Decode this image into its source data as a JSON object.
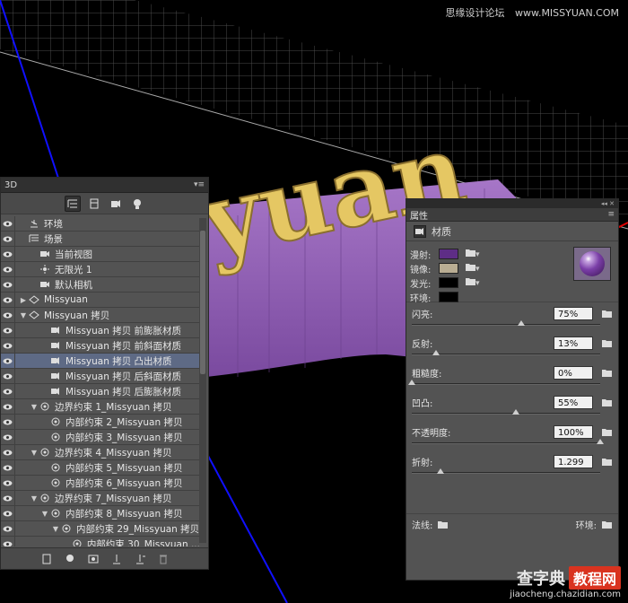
{
  "watermark": {
    "top_site": "思缘设计论坛",
    "top_url": "www.MISSYUAN.COM",
    "bottom_brand_a": "查字典",
    "bottom_brand_b": "教程网",
    "bottom_url": "jiaocheng.chazidian.com"
  },
  "scene_text": "yuan",
  "panel3d": {
    "tab": "3D",
    "rows": [
      {
        "label": "环境",
        "icon": "environment-icon",
        "depth": 0,
        "arrow": ""
      },
      {
        "label": "场景",
        "icon": "scene-icon",
        "depth": 0,
        "arrow": ""
      },
      {
        "label": "当前视图",
        "icon": "camera-view-icon",
        "depth": 1,
        "arrow": ""
      },
      {
        "label": "无限光 1",
        "icon": "light-icon",
        "depth": 1,
        "arrow": ""
      },
      {
        "label": "默认相机",
        "icon": "camera-icon",
        "depth": 1,
        "arrow": ""
      },
      {
        "label": "Missyuan",
        "icon": "mesh-icon",
        "depth": 0,
        "arrow": "▶"
      },
      {
        "label": "Missyuan 拷贝",
        "icon": "mesh-icon",
        "depth": 0,
        "arrow": "▼"
      },
      {
        "label": "Missyuan 拷贝 前膨胀材质",
        "icon": "material-icon",
        "depth": 2,
        "arrow": ""
      },
      {
        "label": "Missyuan 拷贝 前斜面材质",
        "icon": "material-icon",
        "depth": 2,
        "arrow": ""
      },
      {
        "label": "Missyuan 拷贝 凸出材质",
        "icon": "material-icon",
        "depth": 2,
        "arrow": "",
        "selected": true
      },
      {
        "label": "Missyuan 拷贝 后斜面材质",
        "icon": "material-icon",
        "depth": 2,
        "arrow": ""
      },
      {
        "label": "Missyuan 拷贝 后膨胀材质",
        "icon": "material-icon",
        "depth": 2,
        "arrow": ""
      },
      {
        "label": "边界约束 1_Missyuan 拷贝",
        "icon": "constraint-icon",
        "depth": 1,
        "arrow": "▼"
      },
      {
        "label": "内部约束 2_Missyuan 拷贝",
        "icon": "constraint-icon",
        "depth": 2,
        "arrow": ""
      },
      {
        "label": "内部约束 3_Missyuan 拷贝",
        "icon": "constraint-icon",
        "depth": 2,
        "arrow": ""
      },
      {
        "label": "边界约束 4_Missyuan 拷贝",
        "icon": "constraint-icon",
        "depth": 1,
        "arrow": "▼"
      },
      {
        "label": "内部约束 5_Missyuan 拷贝",
        "icon": "constraint-icon",
        "depth": 2,
        "arrow": ""
      },
      {
        "label": "内部约束 6_Missyuan 拷贝",
        "icon": "constraint-icon",
        "depth": 2,
        "arrow": ""
      },
      {
        "label": "边界约束 7_Missyuan 拷贝",
        "icon": "constraint-icon",
        "depth": 1,
        "arrow": "▼"
      },
      {
        "label": "内部约束 8_Missyuan 拷贝",
        "icon": "constraint-icon",
        "depth": 2,
        "arrow": "▼"
      },
      {
        "label": "内部约束 29_Missyuan 拷贝",
        "icon": "constraint-icon",
        "depth": 3,
        "arrow": "▼"
      },
      {
        "label": "内部约束 30_Missyuan ...",
        "icon": "constraint-icon",
        "depth": 4,
        "arrow": ""
      }
    ]
  },
  "properties": {
    "tab": "属性",
    "section": "材质",
    "swatches": [
      {
        "label": "漫射:",
        "color": "#5e2d86"
      },
      {
        "label": "镜像:",
        "color": "#b9ad93"
      },
      {
        "label": "发光:",
        "color": "#000000"
      },
      {
        "label": "环境:",
        "color": "#000000"
      }
    ],
    "sliders": [
      {
        "label": "闪亮:",
        "value": "75%",
        "level": 0.58
      },
      {
        "label": "反射:",
        "value": "13%",
        "level": 0.13
      },
      {
        "label": "粗糙度:",
        "value": "0%",
        "level": 0.0
      },
      {
        "label": "凹凸:",
        "value": "55%",
        "level": 0.55
      },
      {
        "label": "不透明度:",
        "value": "100%",
        "level": 1.0
      },
      {
        "label": "折射:",
        "value": "1.299",
        "level": 0.15
      }
    ],
    "normal_label": "法线:",
    "env_label": "环境:"
  }
}
